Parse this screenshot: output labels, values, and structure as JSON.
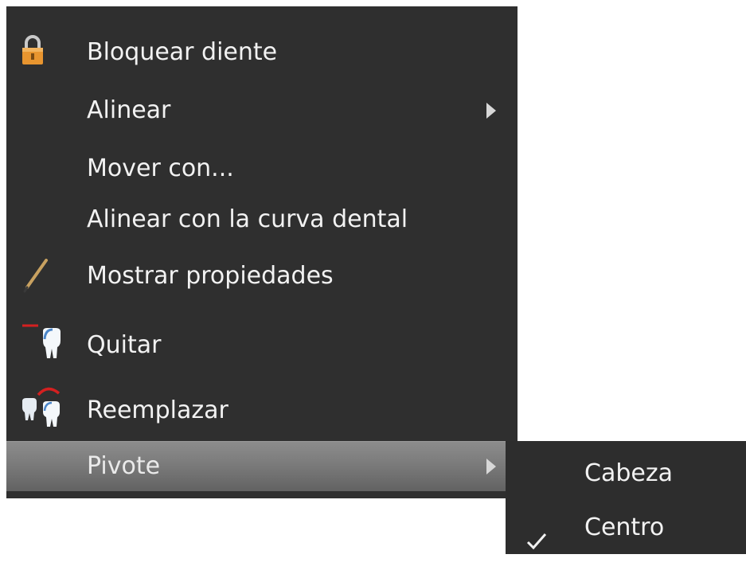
{
  "context_menu": {
    "items": [
      {
        "label": "Bloquear diente",
        "icon": "lock-icon"
      },
      {
        "label": "Alinear",
        "has_submenu": true
      },
      {
        "label": "Mover con..."
      },
      {
        "label": "Alinear con la curva dental"
      },
      {
        "label": "Mostrar propiedades",
        "icon": "pencil-icon"
      },
      {
        "label": "Quitar",
        "icon": "tooth-remove-icon"
      },
      {
        "label": "Reemplazar",
        "icon": "tooth-replace-icon"
      },
      {
        "label": "Pivote",
        "has_submenu": true,
        "highlighted": true
      }
    ]
  },
  "pivot_submenu": {
    "items": [
      {
        "label": "Cabeza",
        "checked": false
      },
      {
        "label": "Centro",
        "checked": true
      }
    ]
  },
  "colors": {
    "menu_background": "#2f2f2f",
    "text": "#f2f2f2",
    "highlight": "#7b7b7b",
    "lock_orange": "#e89a3c",
    "remove_red": "#d42020"
  }
}
